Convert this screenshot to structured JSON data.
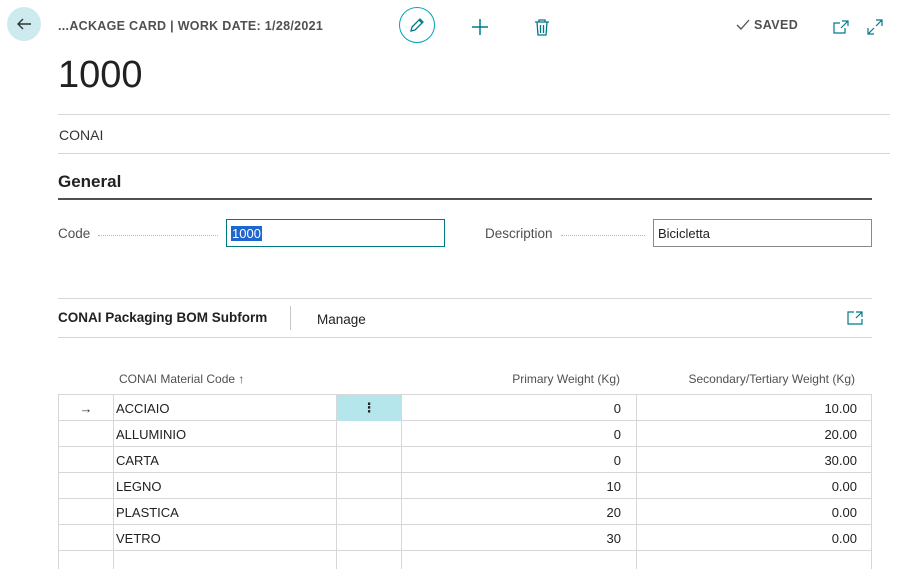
{
  "header": {
    "breadcrumb": "...ACKAGE CARD | WORK DATE: 1/28/2021",
    "saved_label": "SAVED"
  },
  "icons": {
    "back": "arrow-left-icon",
    "edit": "pencil-icon",
    "new": "plus-icon",
    "delete": "trash-icon",
    "open_new": "open-in-new-window-icon",
    "expand": "expand-icon",
    "check": "checkmark-icon"
  },
  "colors": {
    "accent": "#00a5b4",
    "back_bg": "#cdebee",
    "selected_cell": "#b4e6ec",
    "text_selection": "#1e66d0"
  },
  "page": {
    "title": "1000",
    "subtitle": "CONAI"
  },
  "general": {
    "section_title": "General",
    "code_label": "Code",
    "code_value": "1000",
    "description_label": "Description",
    "description_value": "Bicicletta"
  },
  "subform": {
    "title": "CONAI Packaging BOM Subform",
    "manage_label": "Manage",
    "columns": {
      "material": "CONAI Material Code",
      "primary": "Primary Weight (Kg)",
      "secondary": "Secondary/Tertiary Weight (Kg)"
    },
    "sort_indicator": "↑",
    "row_menu_glyph": "⋮",
    "current_row_glyph": "→",
    "rows": [
      {
        "material": "ACCIAIO",
        "primary": "0",
        "secondary": "10.00"
      },
      {
        "material": "ALLUMINIO",
        "primary": "0",
        "secondary": "20.00"
      },
      {
        "material": "CARTA",
        "primary": "0",
        "secondary": "30.00"
      },
      {
        "material": "LEGNO",
        "primary": "10",
        "secondary": "0.00"
      },
      {
        "material": "PLASTICA",
        "primary": "20",
        "secondary": "0.00"
      },
      {
        "material": "VETRO",
        "primary": "30",
        "secondary": "0.00"
      }
    ]
  }
}
